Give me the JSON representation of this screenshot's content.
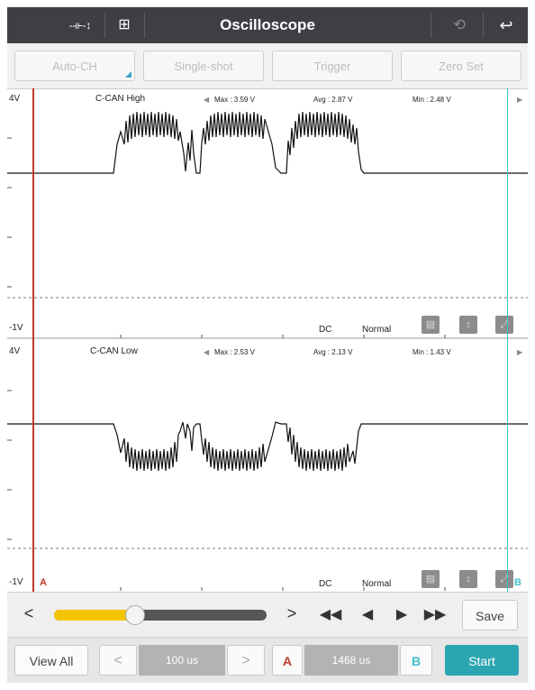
{
  "header": {
    "title": "Oscilloscope"
  },
  "toolbar": {
    "auto_ch": "Auto-CH",
    "single_shot": "Single-shot",
    "trigger": "Trigger",
    "zero_set": "Zero Set"
  },
  "channels": [
    {
      "name": "C-CAN High",
      "max": "Max : 3.59 V",
      "avg": "Avg : 2.87 V",
      "min": "Min : 2.48 V",
      "top_label": "4V",
      "bottom_label": "-1V",
      "coupling": "DC",
      "mode": "Normal"
    },
    {
      "name": "C-CAN Low",
      "max": "Max : 2.53 V",
      "avg": "Avg : 2.13 V",
      "min": "Min : 1.43 V",
      "top_label": "4V",
      "bottom_label": "-1V",
      "coupling": "DC",
      "mode": "Normal"
    }
  ],
  "cursors": {
    "a": "A",
    "b": "B"
  },
  "controls": {
    "prev": "<",
    "next": ">",
    "save": "Save",
    "slider_value": 0.38,
    "view_all": "View All",
    "timebase": "100 us",
    "cursor_a": "A",
    "delta": "1468 us",
    "cursor_b": "B",
    "start": "Start"
  },
  "colors": {
    "cursor_a": "#c0392b",
    "cursor_b": "#3ec1c9",
    "slider_fill": "#f5c400",
    "start_button": "#2aa5b1"
  }
}
